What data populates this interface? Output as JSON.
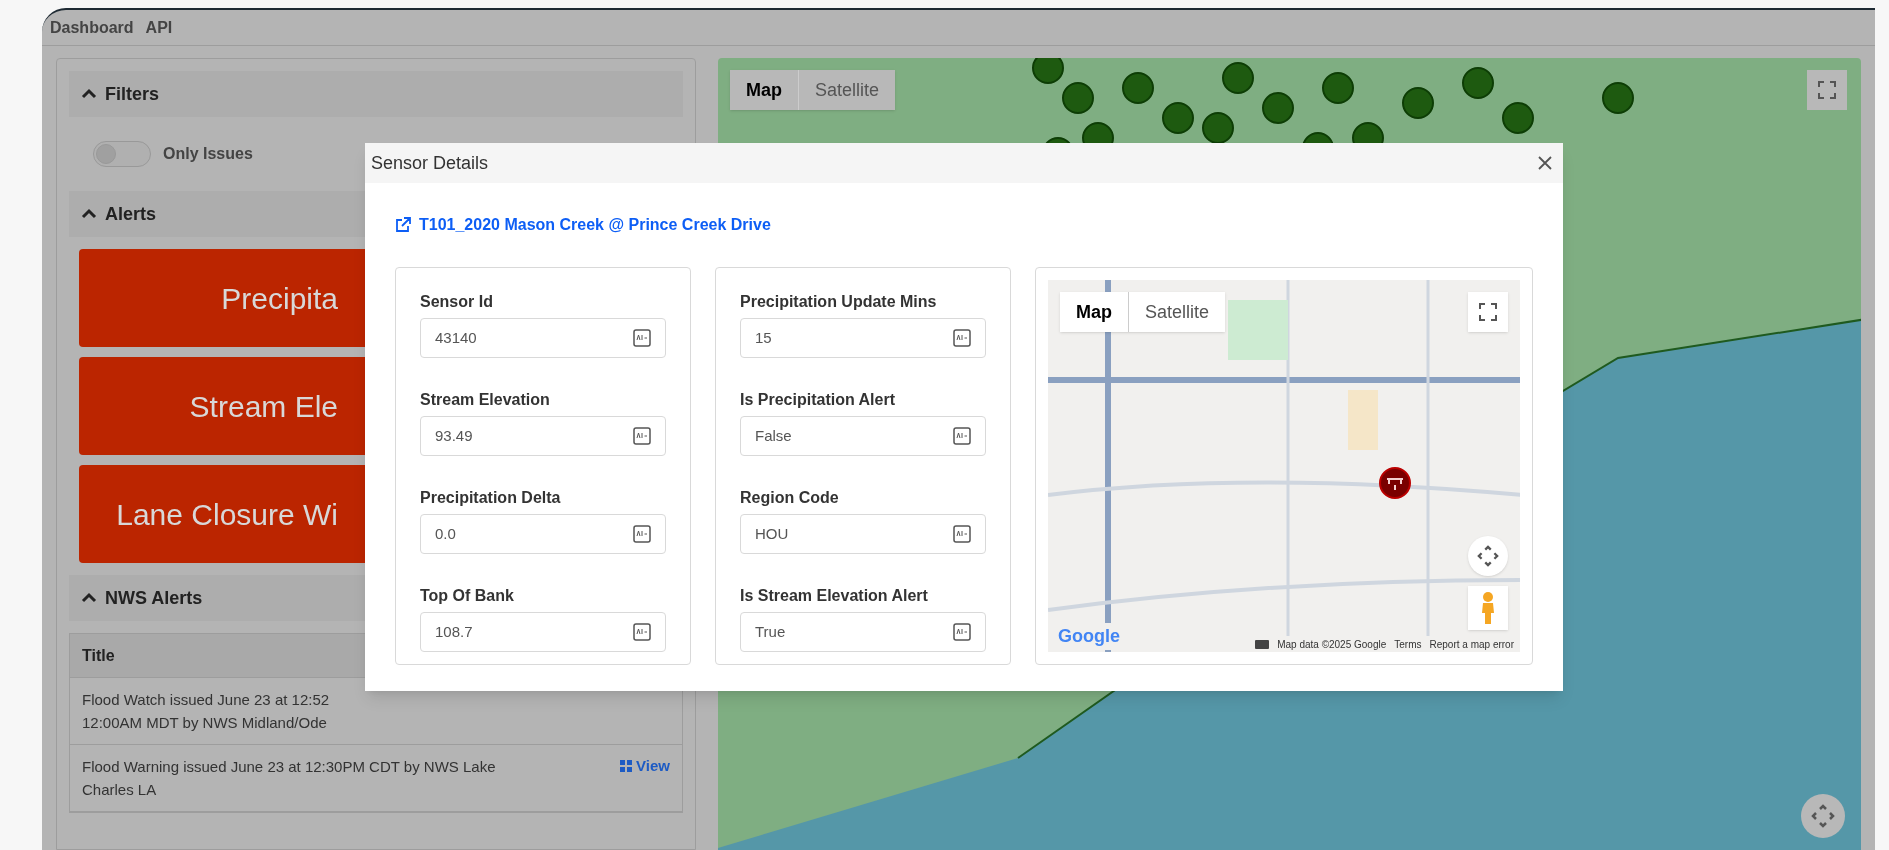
{
  "nav": [
    "Dashboard",
    "API"
  ],
  "filters": {
    "title": "Filters",
    "expanded": true,
    "toggle": {
      "label": "Only Issues",
      "on": false
    }
  },
  "alerts": {
    "title": "Alerts",
    "expanded": true,
    "items": [
      "Precipita",
      "Stream Ele",
      "Lane Closure Wi"
    ]
  },
  "nws_alerts": {
    "title": "NWS Alerts",
    "expanded": true,
    "columns": [
      "Title"
    ],
    "rows": [
      {
        "lines": [
          "Flood Watch issued June 23 at 12:52",
          "12:00AM MDT by NWS Midland/Ode"
        ]
      },
      {
        "lines": [
          "Flood Warning issued June 23 at 12:30PM CDT by NWS Lake",
          "Charles LA"
        ],
        "action": "View"
      }
    ]
  },
  "map": {
    "map_type_buttons": [
      {
        "label": "Map",
        "selected": true
      },
      {
        "label": "Satellite",
        "selected": false
      }
    ]
  },
  "modal": {
    "title": "Sensor Details",
    "link": "T101_2020 Mason Creek @ Prince Creek Drive",
    "columns": [
      [
        {
          "label": "Sensor Id",
          "value": "43140"
        },
        {
          "label": "Stream Elevation",
          "value": "93.49"
        },
        {
          "label": "Precipitation Delta",
          "value": "0.0"
        },
        {
          "label": "Top Of Bank",
          "value": "108.7"
        }
      ],
      [
        {
          "label": "Precipitation Update Mins",
          "value": "15"
        },
        {
          "label": "Is Precipitation Alert",
          "value": "False"
        },
        {
          "label": "Region Code",
          "value": "HOU"
        },
        {
          "label": "Is Stream Elevation Alert",
          "value": "True"
        }
      ]
    ],
    "map": {
      "map_type_buttons": [
        {
          "label": "Map",
          "selected": true
        },
        {
          "label": "Satellite",
          "selected": false
        }
      ],
      "logo": "Google",
      "attribution": [
        "Map data ©2025 Google",
        "Terms",
        "Report a map error"
      ]
    }
  }
}
